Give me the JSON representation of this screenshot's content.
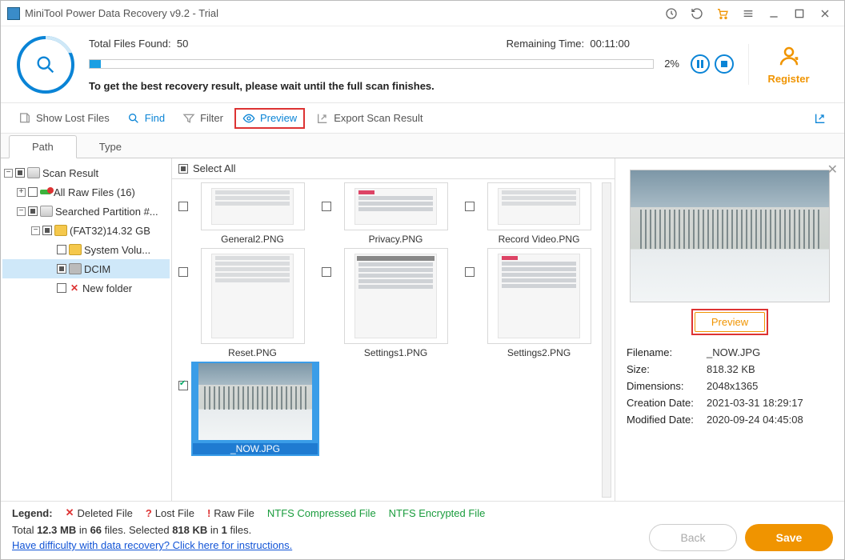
{
  "title": "MiniTool Power Data Recovery v9.2 - Trial",
  "scan": {
    "found_label": "Total Files Found:",
    "found_value": "50",
    "remaining_label": "Remaining Time:",
    "remaining_value": "00:11:00",
    "percent": "2%",
    "hint": "To get the best recovery result, please wait until the full scan finishes."
  },
  "register": "Register",
  "toolbar": {
    "show_lost": "Show Lost Files",
    "find": "Find",
    "filter": "Filter",
    "preview": "Preview",
    "export": "Export Scan Result"
  },
  "tabs": {
    "path": "Path",
    "type": "Type"
  },
  "tree": {
    "root": "Scan Result",
    "raw": "All Raw Files (16)",
    "partition": "Searched Partition #...",
    "fat": "(FAT32)14.32 GB",
    "sysvol": "System Volu...",
    "dcim": "DCIM",
    "newfolder": "New folder"
  },
  "selectall": "Select All",
  "thumbs": {
    "r1": [
      "General2.PNG",
      "Privacy.PNG",
      "Record Video.PNG"
    ],
    "r2": [
      "Reset.PNG",
      "Settings1.PNG",
      "Settings2.PNG"
    ],
    "selected": "_NOW.JPG"
  },
  "preview": {
    "button": "Preview",
    "filename_l": "Filename:",
    "filename_v": "_NOW.JPG",
    "size_l": "Size:",
    "size_v": "818.32 KB",
    "dim_l": "Dimensions:",
    "dim_v": "2048x1365",
    "create_l": "Creation Date:",
    "create_v": "2021-03-31 18:29:17",
    "mod_l": "Modified Date:",
    "mod_v": "2020-09-24 04:45:08"
  },
  "legend": {
    "label": "Legend:",
    "deleted": "Deleted File",
    "lost": "Lost File",
    "raw": "Raw File",
    "ntfs_c": "NTFS Compressed File",
    "ntfs_e": "NTFS Encrypted File"
  },
  "summary": {
    "p1": "Total ",
    "p2": "12.3 MB",
    "p3": " in ",
    "p4": "66",
    "p5": " files.  Selected ",
    "p6": "818 KB",
    "p7": " in ",
    "p8": "1",
    "p9": " files.",
    "help": "Have difficulty with data recovery? Click here for instructions."
  },
  "buttons": {
    "back": "Back",
    "save": "Save"
  }
}
